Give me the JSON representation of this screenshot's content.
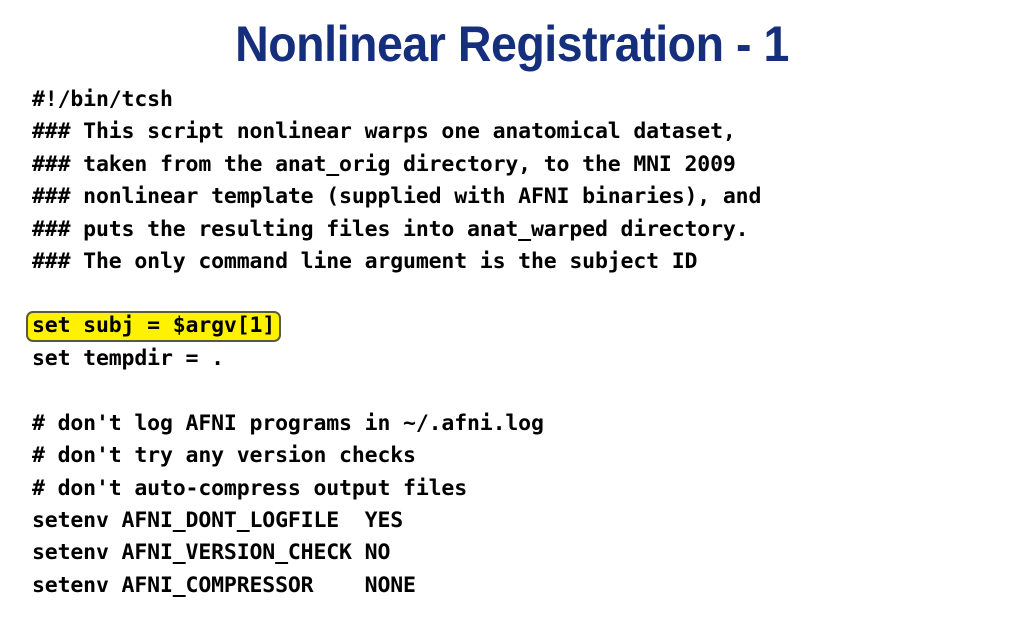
{
  "slide": {
    "title": "Nonlinear Registration - 1",
    "title_color": "#152F7C",
    "background_color": "#FFFFFF",
    "text_color": "#000000",
    "highlight_color": "#FFF200",
    "highlight_border_color": "#5A5A3C"
  },
  "code": {
    "lines": [
      {
        "text": "#!/bin/tcsh",
        "highlight": false
      },
      {
        "text": "### This script nonlinear warps one anatomical dataset,",
        "highlight": false
      },
      {
        "text": "### taken from the anat_orig directory, to the MNI 2009",
        "highlight": false
      },
      {
        "text": "### nonlinear template (supplied with AFNI binaries), and",
        "highlight": false
      },
      {
        "text": "### puts the resulting files into anat_warped directory.",
        "highlight": false
      },
      {
        "text": "### The only command line argument is the subject ID",
        "highlight": false
      },
      {
        "text": "",
        "highlight": false
      },
      {
        "text": "set subj = $argv[1]",
        "highlight": true
      },
      {
        "text": "set tempdir = .",
        "highlight": false
      },
      {
        "text": "",
        "highlight": false
      },
      {
        "text": "# don't log AFNI programs in ~/.afni.log",
        "highlight": false
      },
      {
        "text": "# don't try any version checks",
        "highlight": false
      },
      {
        "text": "# don't auto-compress output files",
        "highlight": false
      },
      {
        "text": "setenv AFNI_DONT_LOGFILE  YES",
        "highlight": false
      },
      {
        "text": "setenv AFNI_VERSION_CHECK NO",
        "highlight": false
      },
      {
        "text": "setenv AFNI_COMPRESSOR    NONE",
        "highlight": false
      }
    ]
  }
}
